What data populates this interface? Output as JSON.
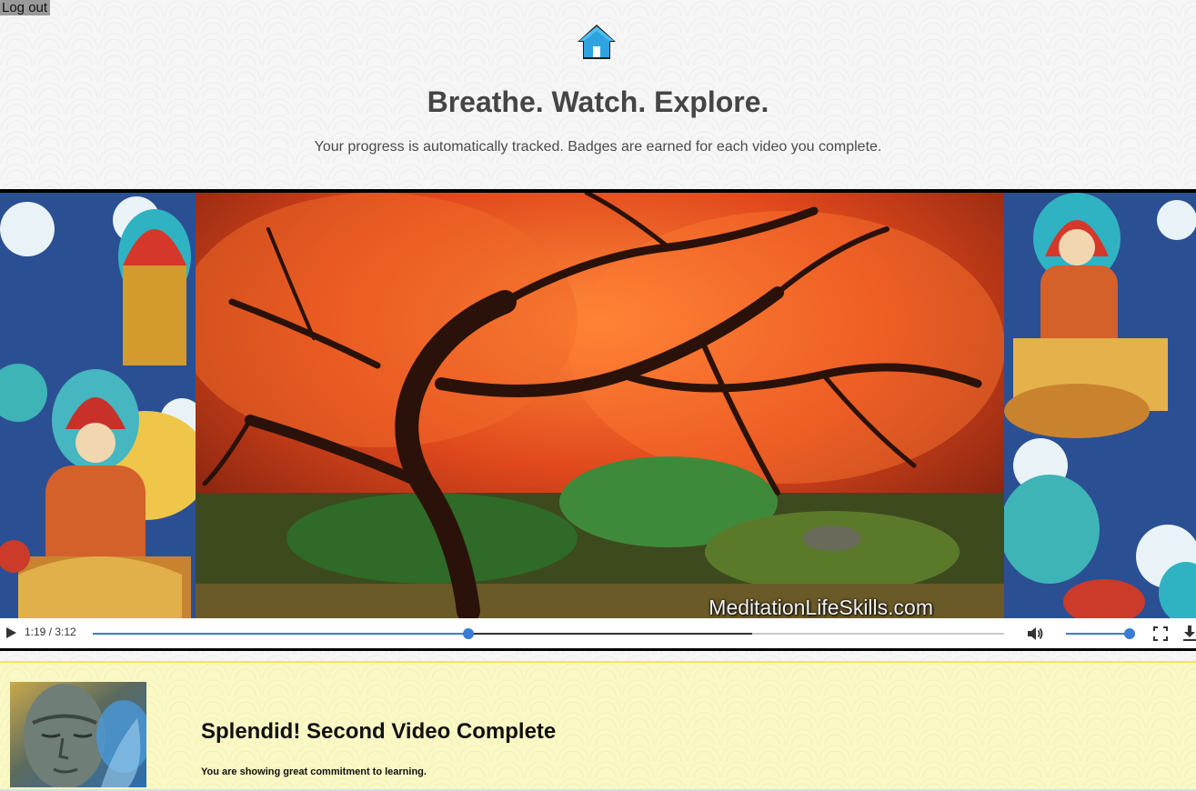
{
  "header": {
    "logout_label": "Log out",
    "home_icon": "home-icon",
    "title": "Breathe. Watch. Explore.",
    "subtitle": "Your progress is automatically tracked. Badges are earned for each video you complete."
  },
  "video": {
    "watermark": "MeditationLifeSkills.com",
    "time": "1:19 / 3:12",
    "progress_played": 0.412,
    "progress_buffered": 0.724,
    "volume_level": 1.0,
    "icons": [
      "play-icon",
      "volume-icon",
      "fullscreen-icon",
      "download-icon"
    ]
  },
  "badge": {
    "title": "Splendid! Second Video Complete",
    "text": "You are showing great commitment to learning."
  },
  "colors": {
    "accent": "#3a7bd5",
    "badge_bg": "#faf8c4",
    "badge_border": "#f2e94a",
    "home_icon": "#2ea3e0"
  }
}
